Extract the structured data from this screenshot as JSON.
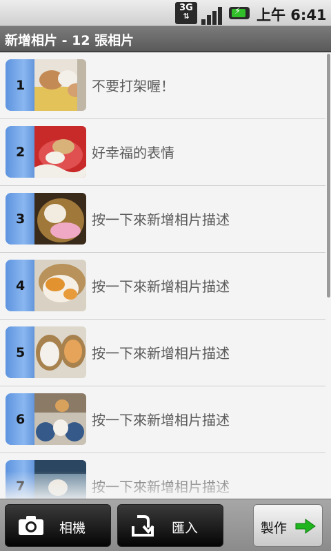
{
  "status_bar": {
    "network": "3G",
    "time": "上午 6:41",
    "icons": [
      "network-3g-icon",
      "signal-icon",
      "battery-charging-icon"
    ]
  },
  "title": "新增相片 - 12 張相片",
  "photos": [
    {
      "number": "1",
      "caption": "不要打架喔！"
    },
    {
      "number": "2",
      "caption": "好幸福的表情"
    },
    {
      "number": "3",
      "caption": "按一下來新增相片描述"
    },
    {
      "number": "4",
      "caption": "按一下來新增相片描述"
    },
    {
      "number": "5",
      "caption": "按一下來新增相片描述"
    },
    {
      "number": "6",
      "caption": "按一下來新增相片描述"
    },
    {
      "number": "7",
      "caption": "按一下來新增相片描述"
    }
  ],
  "bottom_bar": {
    "camera_label": "相機",
    "import_label": "匯入",
    "make_label": "製作"
  },
  "colors": {
    "number_tab": "#6d9fe3",
    "make_arrow": "#1fb51f"
  }
}
